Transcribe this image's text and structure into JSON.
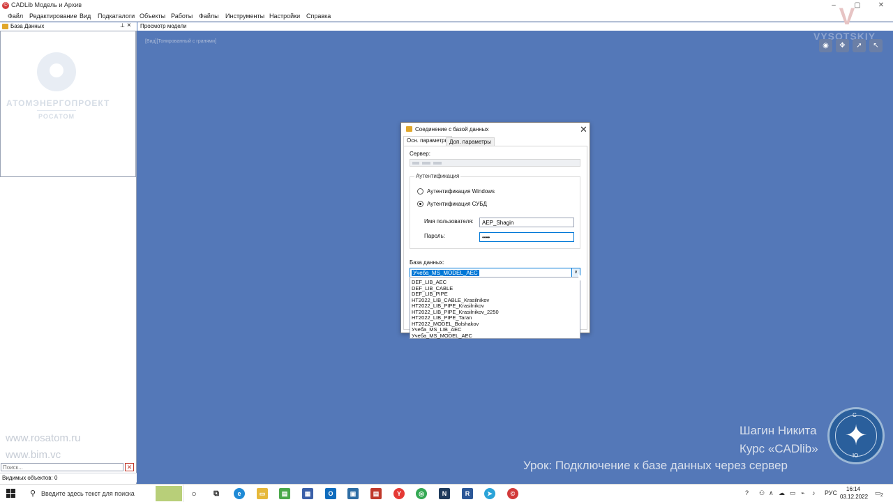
{
  "window": {
    "title": "CADLib Модель и Архив",
    "minimize": "–",
    "maximize": "▢",
    "close": "✕"
  },
  "menu": [
    "Файл",
    "Редактирование",
    "Вид",
    "Подкаталоги",
    "Объекты",
    "Работы",
    "Файлы",
    "Инструменты",
    "Настройки",
    "Справка"
  ],
  "db_panel": {
    "title": "База Данных",
    "pin": "⊥",
    "close": "×",
    "watermark": {
      "company": "АТОМЭНЕРГОПРОЕКТ",
      "group": "РОСАТОМ",
      "url1": "www.rosatom.ru",
      "url2": "www.bim.vc"
    },
    "search_placeholder": "Поиск...",
    "search_clear": "✕",
    "status": "Видимых объектов: 0"
  },
  "model_view": {
    "tab": "Просмотр модели",
    "view_label": "[Вид][Тонированный с гранями]",
    "brand": "VYSOTSKIY",
    "toolbar_icons": [
      "eye-icon",
      "globe-icon",
      "navigate-icon",
      "pointer-icon"
    ],
    "author": "Шагин Никита",
    "course": "Курс «CADlib»",
    "lesson": "Урок: Подключение к базе данных через сервер",
    "compass_letters": [
      "С",
      "Ю"
    ]
  },
  "dialog": {
    "title": "Соединение с базой данных",
    "close": "✕",
    "tabs": [
      "Осн. параметры",
      "Доп. параметры"
    ],
    "server_label": "Сервер:",
    "auth": {
      "title": "Аутентификация",
      "windows": "Аутентификация Windows",
      "dbms": "Аутентификация СУБД",
      "selected": "dbms"
    },
    "username_label": "Имя пользователя:",
    "username_value": "AEP_Shagin",
    "password_label": "Пароль:",
    "password_value": "••••",
    "db_label": "База данных:",
    "db_selected": "Учеба_MS_MODEL_AEC",
    "db_options": [
      "DEF_LIB_AEC",
      "DEF_LIB_CABLE",
      "DEF_LIB_PIPE",
      "HT2022_LIB_CABLE_Krasilnikov",
      "HT2022_LIB_PIPE_Krasilnikov",
      "HT2022_LIB_PIPE_Krasilnikov_2250",
      "HT2022_LIB_PIPE_Taran",
      "HT2022_MODEL_Bolshakov",
      "Учеба_MS_LIB_AEC",
      "Учеба_MS_MODEL_AEC"
    ]
  },
  "taskbar": {
    "search_placeholder": "Введите здесь текст для поиска",
    "language": "РУС",
    "time": "16:14",
    "date": "03.12.2022",
    "notification_count": "2"
  }
}
